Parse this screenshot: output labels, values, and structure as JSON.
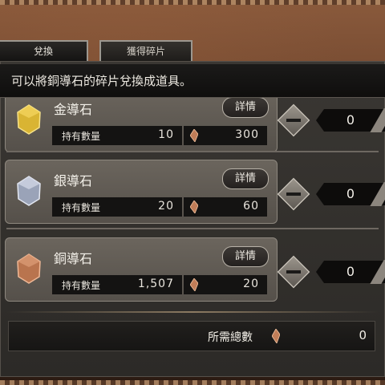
{
  "tabs": [
    {
      "label": "兌換",
      "active": true
    },
    {
      "label": "獲得碎片",
      "active": false
    }
  ],
  "header": {
    "instruction": "可以將銅導石的碎片兌換成道具。"
  },
  "items": [
    {
      "name": "金導石",
      "ore_color": "#d9b433",
      "detail_label": "詳情",
      "held_label": "持有數量",
      "held_value": "10",
      "cost": "300",
      "count": "0"
    },
    {
      "name": "銀導石",
      "ore_color": "#9aa3b8",
      "detail_label": "詳情",
      "held_label": "持有數量",
      "held_value": "20",
      "cost": "60",
      "count": "0"
    },
    {
      "name": "銅導石",
      "ore_color": "#b9744e",
      "detail_label": "詳情",
      "held_label": "持有數量",
      "held_value": "1,507",
      "cost": "20",
      "count": "0"
    }
  ],
  "total": {
    "label": "所需總數",
    "value": "0"
  }
}
